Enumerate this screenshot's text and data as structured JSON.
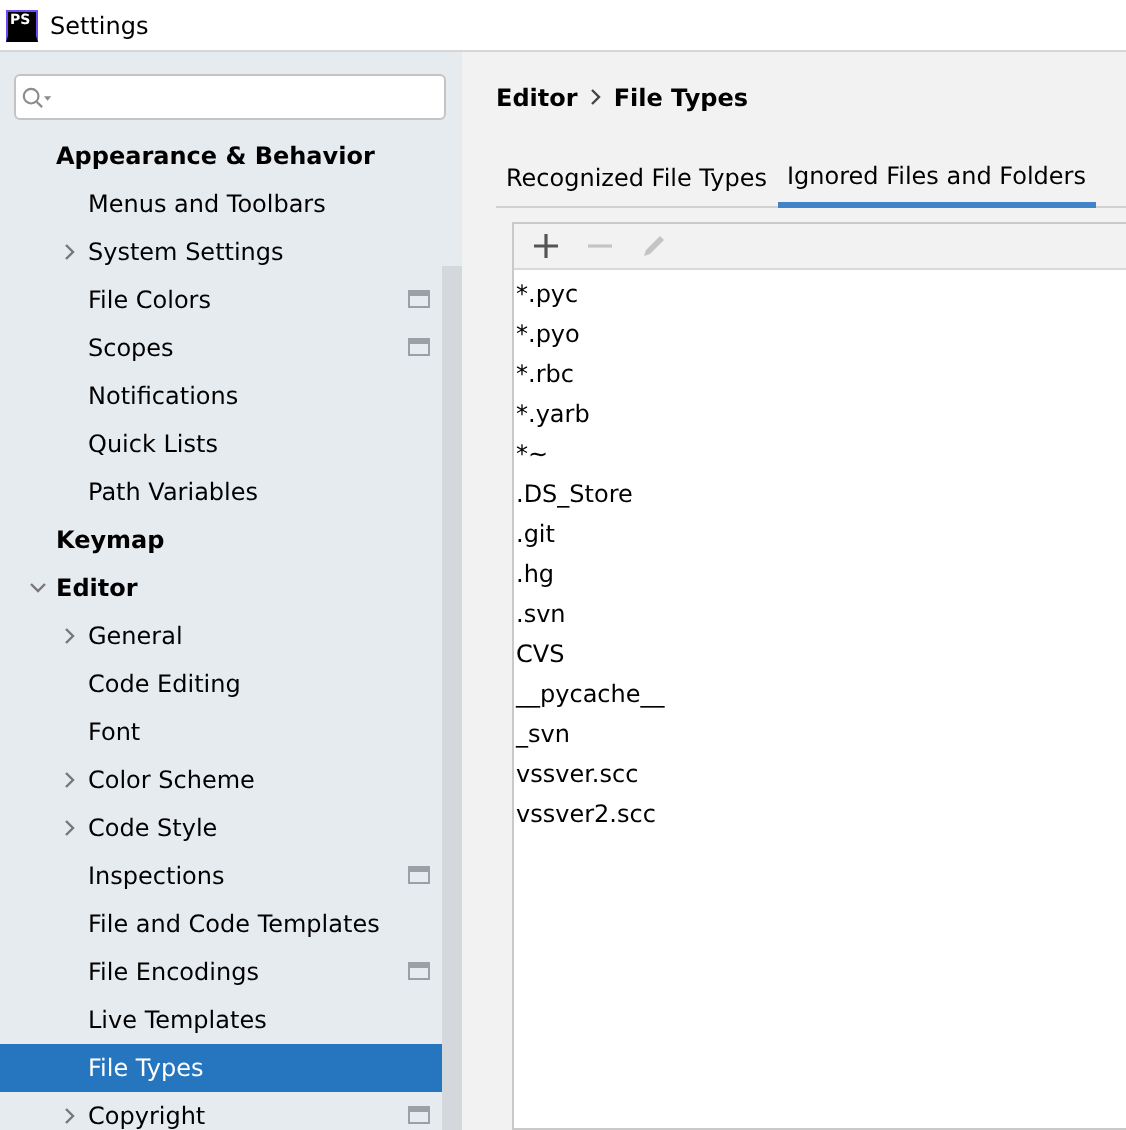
{
  "window": {
    "logo": "PS",
    "title": "Settings"
  },
  "tree": [
    {
      "label": "Appearance & Behavior",
      "kind": "group",
      "children": [
        {
          "label": "Menus and Toolbars"
        },
        {
          "label": "System Settings",
          "expanded": false
        },
        {
          "label": "File Colors",
          "project_level": true
        },
        {
          "label": "Scopes",
          "project_level": true
        },
        {
          "label": "Notifications"
        },
        {
          "label": "Quick Lists"
        },
        {
          "label": "Path Variables"
        }
      ]
    },
    {
      "label": "Keymap",
      "kind": "group"
    },
    {
      "label": "Editor",
      "kind": "group",
      "expanded": true,
      "children": [
        {
          "label": "General",
          "expanded": false
        },
        {
          "label": "Code Editing"
        },
        {
          "label": "Font"
        },
        {
          "label": "Color Scheme",
          "expanded": false
        },
        {
          "label": "Code Style",
          "expanded": false
        },
        {
          "label": "Inspections",
          "project_level": true
        },
        {
          "label": "File and Code Templates"
        },
        {
          "label": "File Encodings",
          "project_level": true
        },
        {
          "label": "Live Templates"
        },
        {
          "label": "File Types",
          "selected": true
        },
        {
          "label": "Copyright",
          "expanded": false,
          "project_level": true
        }
      ]
    }
  ],
  "breadcrumb": [
    "Editor",
    "File Types"
  ],
  "tabs": [
    {
      "label": "Recognized File Types",
      "selected": false
    },
    {
      "label": "Ignored Files and Folders",
      "selected": true
    }
  ],
  "toolbar": [
    {
      "kind": "add",
      "disabled": false
    },
    {
      "kind": "remove",
      "disabled": true
    },
    {
      "kind": "edit",
      "disabled": true
    }
  ],
  "patterns": [
    "*.pyc",
    "*.pyo",
    "*.rbc",
    "*.yarb",
    "*~",
    ".DS_Store",
    ".git",
    ".hg",
    ".svn",
    "CVS",
    "__pycache__",
    "_svn",
    "vssver.scc",
    "vssver2.scc"
  ]
}
